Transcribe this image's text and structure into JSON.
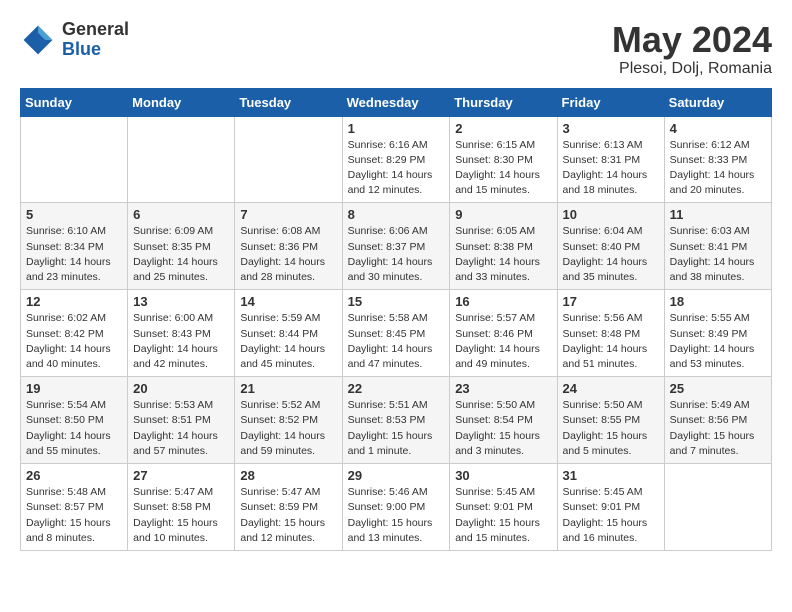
{
  "header": {
    "logo_general": "General",
    "logo_blue": "Blue",
    "month_year": "May 2024",
    "location": "Plesoi, Dolj, Romania"
  },
  "days_of_week": [
    "Sunday",
    "Monday",
    "Tuesday",
    "Wednesday",
    "Thursday",
    "Friday",
    "Saturday"
  ],
  "weeks": [
    [
      {
        "day": "",
        "info": ""
      },
      {
        "day": "",
        "info": ""
      },
      {
        "day": "",
        "info": ""
      },
      {
        "day": "1",
        "info": "Sunrise: 6:16 AM\nSunset: 8:29 PM\nDaylight: 14 hours\nand 12 minutes."
      },
      {
        "day": "2",
        "info": "Sunrise: 6:15 AM\nSunset: 8:30 PM\nDaylight: 14 hours\nand 15 minutes."
      },
      {
        "day": "3",
        "info": "Sunrise: 6:13 AM\nSunset: 8:31 PM\nDaylight: 14 hours\nand 18 minutes."
      },
      {
        "day": "4",
        "info": "Sunrise: 6:12 AM\nSunset: 8:33 PM\nDaylight: 14 hours\nand 20 minutes."
      }
    ],
    [
      {
        "day": "5",
        "info": "Sunrise: 6:10 AM\nSunset: 8:34 PM\nDaylight: 14 hours\nand 23 minutes."
      },
      {
        "day": "6",
        "info": "Sunrise: 6:09 AM\nSunset: 8:35 PM\nDaylight: 14 hours\nand 25 minutes."
      },
      {
        "day": "7",
        "info": "Sunrise: 6:08 AM\nSunset: 8:36 PM\nDaylight: 14 hours\nand 28 minutes."
      },
      {
        "day": "8",
        "info": "Sunrise: 6:06 AM\nSunset: 8:37 PM\nDaylight: 14 hours\nand 30 minutes."
      },
      {
        "day": "9",
        "info": "Sunrise: 6:05 AM\nSunset: 8:38 PM\nDaylight: 14 hours\nand 33 minutes."
      },
      {
        "day": "10",
        "info": "Sunrise: 6:04 AM\nSunset: 8:40 PM\nDaylight: 14 hours\nand 35 minutes."
      },
      {
        "day": "11",
        "info": "Sunrise: 6:03 AM\nSunset: 8:41 PM\nDaylight: 14 hours\nand 38 minutes."
      }
    ],
    [
      {
        "day": "12",
        "info": "Sunrise: 6:02 AM\nSunset: 8:42 PM\nDaylight: 14 hours\nand 40 minutes."
      },
      {
        "day": "13",
        "info": "Sunrise: 6:00 AM\nSunset: 8:43 PM\nDaylight: 14 hours\nand 42 minutes."
      },
      {
        "day": "14",
        "info": "Sunrise: 5:59 AM\nSunset: 8:44 PM\nDaylight: 14 hours\nand 45 minutes."
      },
      {
        "day": "15",
        "info": "Sunrise: 5:58 AM\nSunset: 8:45 PM\nDaylight: 14 hours\nand 47 minutes."
      },
      {
        "day": "16",
        "info": "Sunrise: 5:57 AM\nSunset: 8:46 PM\nDaylight: 14 hours\nand 49 minutes."
      },
      {
        "day": "17",
        "info": "Sunrise: 5:56 AM\nSunset: 8:48 PM\nDaylight: 14 hours\nand 51 minutes."
      },
      {
        "day": "18",
        "info": "Sunrise: 5:55 AM\nSunset: 8:49 PM\nDaylight: 14 hours\nand 53 minutes."
      }
    ],
    [
      {
        "day": "19",
        "info": "Sunrise: 5:54 AM\nSunset: 8:50 PM\nDaylight: 14 hours\nand 55 minutes."
      },
      {
        "day": "20",
        "info": "Sunrise: 5:53 AM\nSunset: 8:51 PM\nDaylight: 14 hours\nand 57 minutes."
      },
      {
        "day": "21",
        "info": "Sunrise: 5:52 AM\nSunset: 8:52 PM\nDaylight: 14 hours\nand 59 minutes."
      },
      {
        "day": "22",
        "info": "Sunrise: 5:51 AM\nSunset: 8:53 PM\nDaylight: 15 hours\nand 1 minute."
      },
      {
        "day": "23",
        "info": "Sunrise: 5:50 AM\nSunset: 8:54 PM\nDaylight: 15 hours\nand 3 minutes."
      },
      {
        "day": "24",
        "info": "Sunrise: 5:50 AM\nSunset: 8:55 PM\nDaylight: 15 hours\nand 5 minutes."
      },
      {
        "day": "25",
        "info": "Sunrise: 5:49 AM\nSunset: 8:56 PM\nDaylight: 15 hours\nand 7 minutes."
      }
    ],
    [
      {
        "day": "26",
        "info": "Sunrise: 5:48 AM\nSunset: 8:57 PM\nDaylight: 15 hours\nand 8 minutes."
      },
      {
        "day": "27",
        "info": "Sunrise: 5:47 AM\nSunset: 8:58 PM\nDaylight: 15 hours\nand 10 minutes."
      },
      {
        "day": "28",
        "info": "Sunrise: 5:47 AM\nSunset: 8:59 PM\nDaylight: 15 hours\nand 12 minutes."
      },
      {
        "day": "29",
        "info": "Sunrise: 5:46 AM\nSunset: 9:00 PM\nDaylight: 15 hours\nand 13 minutes."
      },
      {
        "day": "30",
        "info": "Sunrise: 5:45 AM\nSunset: 9:01 PM\nDaylight: 15 hours\nand 15 minutes."
      },
      {
        "day": "31",
        "info": "Sunrise: 5:45 AM\nSunset: 9:01 PM\nDaylight: 15 hours\nand 16 minutes."
      },
      {
        "day": "",
        "info": ""
      }
    ]
  ]
}
